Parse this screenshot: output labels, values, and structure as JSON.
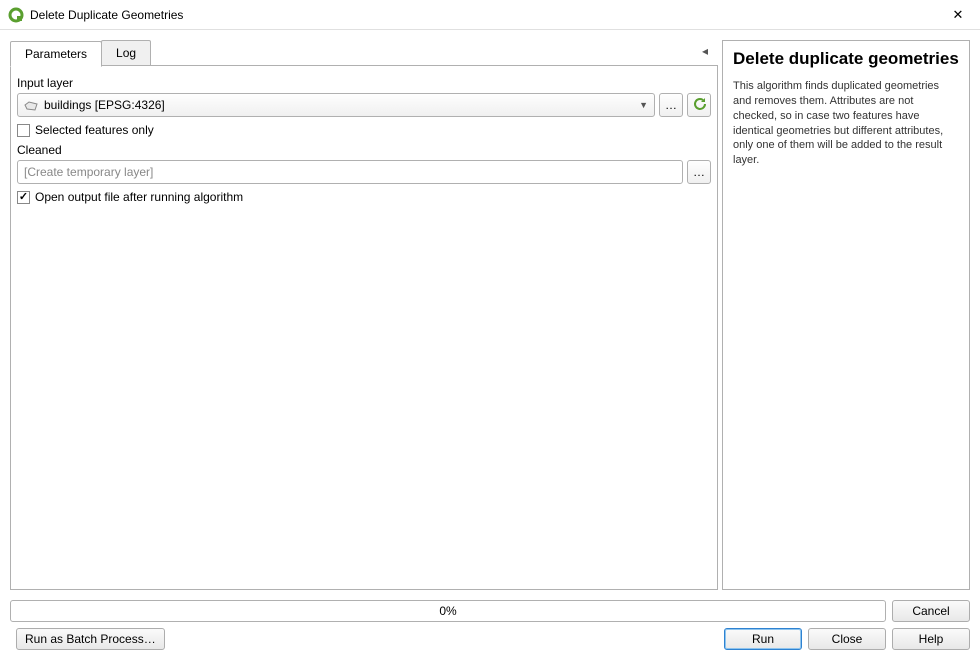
{
  "window": {
    "title": "Delete Duplicate Geometries"
  },
  "tabs": {
    "parameters": "Parameters",
    "log": "Log"
  },
  "form": {
    "input_layer_label": "Input layer",
    "input_layer_value": "buildings [EPSG:4326]",
    "selected_only_label": "Selected features only",
    "output_label": "Cleaned",
    "output_placeholder": "[Create temporary layer]",
    "open_after_label": "Open output file after running algorithm"
  },
  "help": {
    "title": "Delete duplicate geometries",
    "body": "This algorithm finds duplicated geometries and removes them. Attributes are not checked, so in case two features have identical geometries but different attributes, only one of them will be added to the result layer."
  },
  "progress": {
    "text": "0%"
  },
  "buttons": {
    "cancel": "Cancel",
    "batch": "Run as Batch Process…",
    "run": "Run",
    "close": "Close",
    "help": "Help",
    "browse": "…"
  }
}
